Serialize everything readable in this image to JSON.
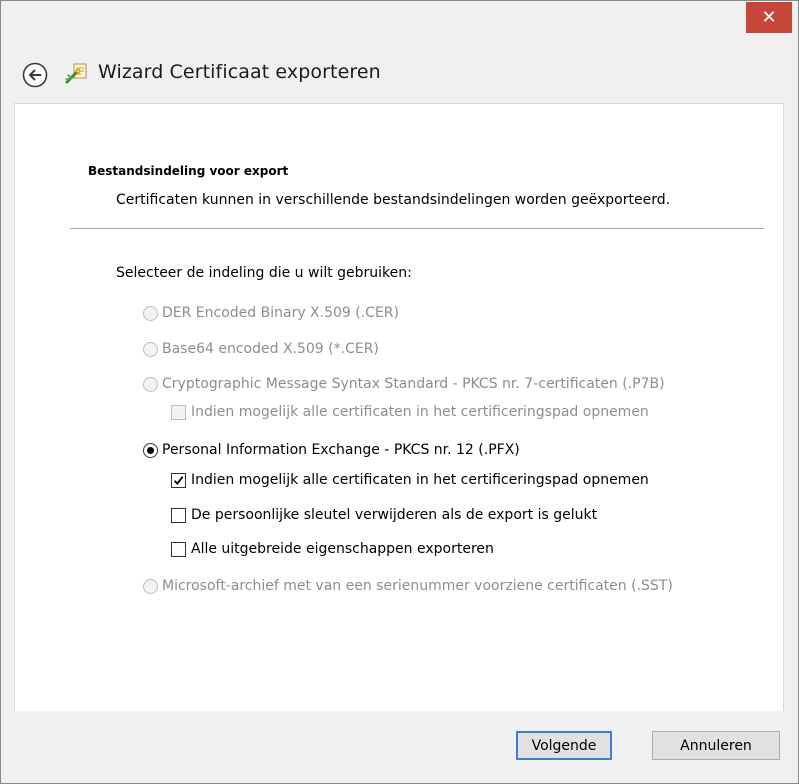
{
  "window": {
    "close_glyph": "✕"
  },
  "header": {
    "title": "Wizard Certificaat exporteren",
    "back_icon": "back-arrow-icon",
    "wizard_icon": "certificate-wizard-icon"
  },
  "page": {
    "section_title": "Bestandsindeling voor export",
    "section_desc": "Certificaten kunnen in verschillende bestandsindelingen worden geëxporteerd.",
    "select_label": "Selecteer de indeling die u wilt gebruiken:"
  },
  "options": {
    "der": {
      "label": "DER Encoded Binary X.509 (.CER)",
      "enabled": false,
      "selected": false
    },
    "base64": {
      "label": "Base64 encoded X.509 (*.CER)",
      "enabled": false,
      "selected": false
    },
    "pkcs7": {
      "label": "Cryptographic Message Syntax Standard - PKCS nr. 7-certificaten (.P7B)",
      "enabled": false,
      "selected": false
    },
    "pkcs7_include_all": {
      "label": "Indien mogelijk alle certificaten in het certificeringspad opnemen",
      "enabled": false,
      "checked": false
    },
    "pfx": {
      "label": "Personal Information Exchange - PKCS nr. 12 (.PFX)",
      "enabled": true,
      "selected": true
    },
    "pfx_include_all": {
      "label": "Indien mogelijk alle certificaten in het certificeringspad opnemen",
      "enabled": true,
      "checked": true
    },
    "pfx_delete_key": {
      "label": "De persoonlijke sleutel verwijderen als de export is gelukt",
      "enabled": true,
      "checked": false
    },
    "pfx_export_props": {
      "label": "Alle uitgebreide eigenschappen exporteren",
      "enabled": true,
      "checked": false
    },
    "sst": {
      "label": "Microsoft-archief met van een serienummer voorziene certificaten (.SST)",
      "enabled": false,
      "selected": false
    }
  },
  "footer": {
    "next_label": "Volgende",
    "cancel_label": "Annuleren"
  },
  "colors": {
    "close_button": "#c7463a",
    "primary_border": "#3c7fd0",
    "disabled_text": "#8d8d8d"
  }
}
